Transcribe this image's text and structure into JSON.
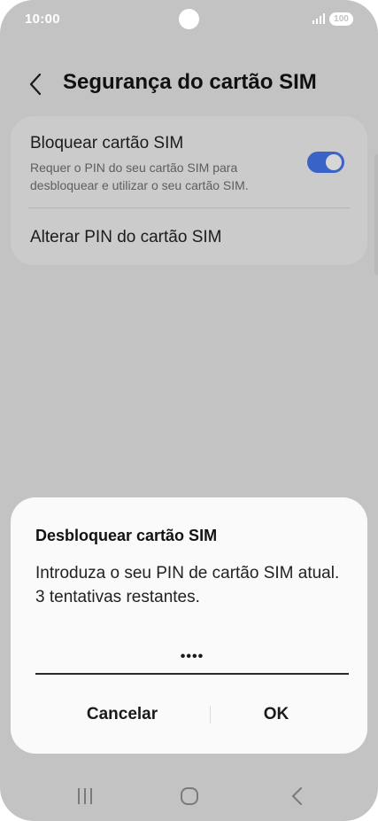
{
  "status_bar": {
    "time": "10:00",
    "battery": "100"
  },
  "header": {
    "title": "Segurança do cartão SIM"
  },
  "settings": {
    "lock_sim": {
      "title": "Bloquear cartão SIM",
      "description": "Requer o PIN do seu cartão SIM para desbloquear e utilizar o seu cartão SIM.",
      "enabled": true
    },
    "change_pin": {
      "title": "Alterar PIN do cartão SIM"
    }
  },
  "dialog": {
    "title": "Desbloquear cartão SIM",
    "message": "Introduza o seu PIN de cartão SIM atual.",
    "attempts": "3 tentativas restantes.",
    "pin_value": "••••",
    "cancel_label": "Cancelar",
    "ok_label": "OK"
  },
  "nav_bar": {
    "icons": [
      "recents-icon",
      "home-icon",
      "back-icon"
    ]
  },
  "colors": {
    "background_dim": "#c3c3c3",
    "toggle_on": "#3a63c8",
    "dialog_bg": "#fafafa"
  }
}
